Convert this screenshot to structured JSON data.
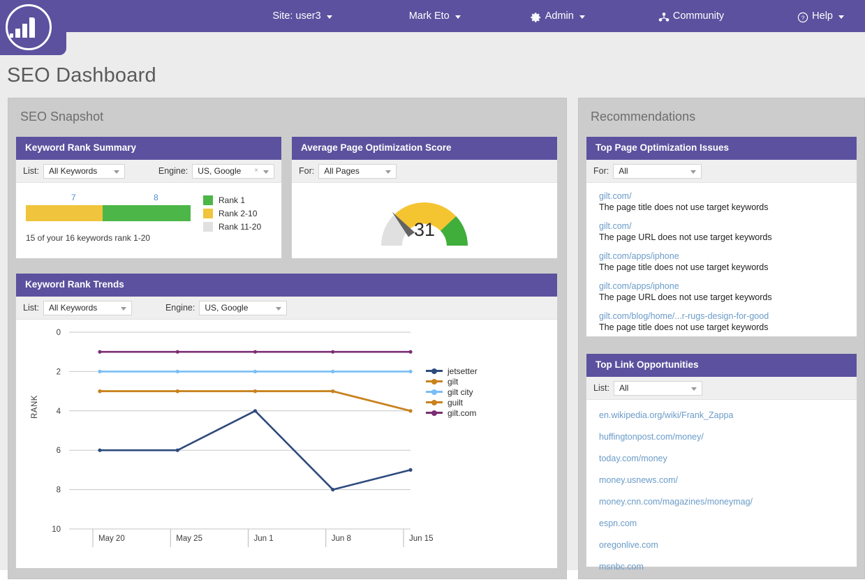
{
  "topnav": {
    "logo_name": "bar-chart-logo",
    "items": [
      {
        "label": "Site: user3",
        "icon": "",
        "caret": true
      },
      {
        "label": "Mark Eto",
        "icon": "",
        "caret": true
      },
      {
        "label": "Admin",
        "icon": "gear-icon",
        "caret": true
      },
      {
        "label": "Community",
        "icon": "community-icon",
        "caret": false
      },
      {
        "label": "Help",
        "icon": "question-circle-icon",
        "caret": true
      }
    ]
  },
  "page": {
    "title": "SEO Dashboard"
  },
  "left_column": {
    "heading": "SEO Snapshot"
  },
  "right_column": {
    "heading": "Recommendations"
  },
  "keyword_rank_summary": {
    "title": "Keyword Rank Summary",
    "list_label": "List:",
    "list_value": "All Keywords",
    "engine_label": "Engine:",
    "engine_value": "US, Google",
    "engine_clear": "×",
    "bar": {
      "segments": [
        {
          "label": "7",
          "value": 7,
          "color": "#f0c43c",
          "legend": "Rank 2-10"
        },
        {
          "label": "8",
          "value": 8,
          "color": "#4cb648",
          "legend": "Rank 1"
        }
      ]
    },
    "legend": [
      {
        "label": "Rank 1",
        "color": "#4cb648"
      },
      {
        "label": "Rank 2-10",
        "color": "#f0c43c"
      },
      {
        "label": "Rank 11-20",
        "color": "#e0e0e0"
      }
    ],
    "note": "15 of your 16 keywords rank 1-20"
  },
  "page_optimization_score": {
    "title": "Average Page Optimization Score",
    "for_label": "For:",
    "for_value": "All Pages",
    "gauge": {
      "value": "31",
      "min": 0,
      "max": 100,
      "needle_at": 31,
      "bands": [
        {
          "from": 0,
          "to": 31,
          "color": "#e0e0e0"
        },
        {
          "from": 31,
          "to": 64,
          "color": "#f5c431"
        },
        {
          "from": 64,
          "to": 100,
          "color": "#3fae3a"
        }
      ]
    }
  },
  "keyword_rank_trends": {
    "title": "Keyword Rank Trends",
    "list_label": "List:",
    "list_value": "All Keywords",
    "engine_label": "Engine:",
    "engine_value": "US, Google"
  },
  "chart_data": {
    "type": "line",
    "title": "Keyword Rank Trends",
    "xlabel": "",
    "ylabel": "RANK",
    "x": [
      "May 20",
      "May 25",
      "Jun 1",
      "Jun 8",
      "Jun 15"
    ],
    "yticks": [
      0,
      2,
      4,
      6,
      8,
      10
    ],
    "ylim": [
      0,
      10
    ],
    "y_inverted": true,
    "grid": "horizontal",
    "legend_position": "right",
    "series": [
      {
        "name": "jetsetter",
        "color": "#2e4a7d",
        "values": [
          6,
          6,
          4,
          8,
          7
        ]
      },
      {
        "name": "gilt",
        "color": "#c8821e",
        "values": [
          3,
          3,
          3,
          3,
          4
        ]
      },
      {
        "name": "gilt city",
        "color": "#79bdf5",
        "values": [
          2,
          2,
          2,
          2,
          2
        ]
      },
      {
        "name": "guilt",
        "color": "#c8821e",
        "values": [
          3,
          3,
          3,
          3,
          4
        ]
      },
      {
        "name": "gilt.com",
        "color": "#7b2d73",
        "values": [
          1,
          1,
          1,
          1,
          1
        ]
      }
    ]
  },
  "top_page_optimization_issues": {
    "title": "Top Page Optimization Issues",
    "for_label": "For:",
    "for_value": "All",
    "items": [
      {
        "url": "gilt.com/",
        "desc": "The page title does not use target keywords"
      },
      {
        "url": "gilt.com/",
        "desc": "The page URL does not use target keywords"
      },
      {
        "url": "gilt.com/apps/iphone",
        "desc": "The page title does not use target keywords"
      },
      {
        "url": "gilt.com/apps/iphone",
        "desc": "The page URL does not use target keywords"
      },
      {
        "url": "gilt.com/blog/home/...r-rugs-design-for-good",
        "desc": "The page title does not use target keywords"
      }
    ]
  },
  "top_link_opportunities": {
    "title": "Top Link Opportunities",
    "list_label": "List:",
    "list_value": "All",
    "items": [
      "en.wikipedia.org/wiki/Frank_Zappa",
      "huffingtonpost.com/money/",
      "today.com/money",
      "money.usnews.com/",
      "money.cnn.com/magazines/moneymag/",
      "espn.com",
      "oregonlive.com",
      "msnbc.com"
    ]
  },
  "colors": {
    "brand_purple": "#5b519e",
    "page_bg": "#ececec",
    "panel_bg": "#cccccc",
    "link_blue": "#6a9bc8"
  }
}
